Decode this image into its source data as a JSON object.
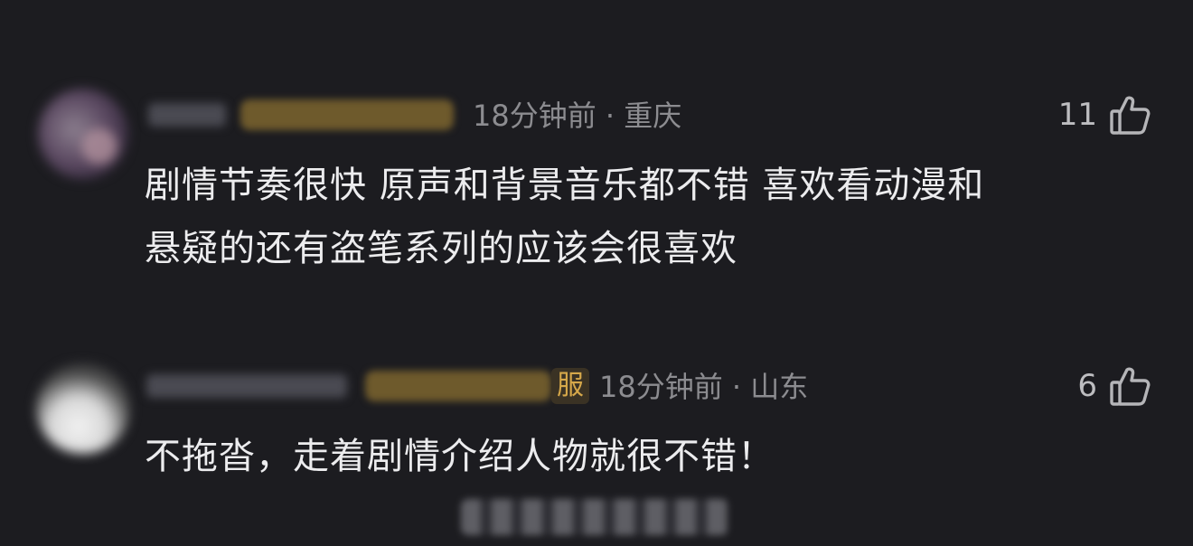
{
  "comments": [
    {
      "time": "18分钟前",
      "location": "重庆",
      "likes": "11",
      "text_line1": "剧情节奏很快 原声和背景音乐都不错 喜欢看动漫和",
      "text_line2": "悬疑的还有盗笔系列的应该会很喜欢"
    },
    {
      "badge_suffix": "服",
      "time": "18分钟前",
      "location": "山东",
      "likes": "6",
      "text_line1": "不拖沓，走着剧情介绍人物就很不错！"
    }
  ],
  "separator": " · ",
  "icons": {
    "like": "thumbs-up-icon"
  },
  "colors": {
    "background": "#1c1c20",
    "text": "#ececee",
    "meta": "#8c8c90",
    "badge": "#d6a84a"
  }
}
